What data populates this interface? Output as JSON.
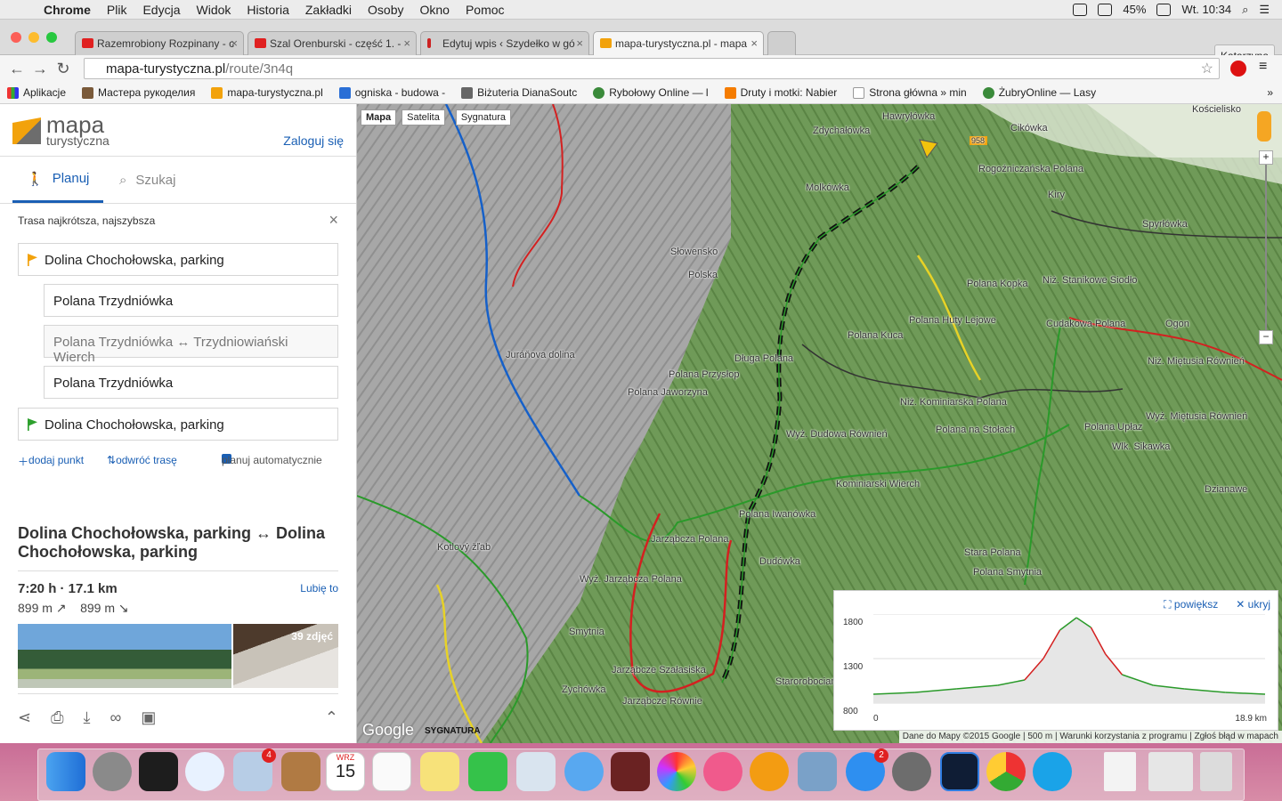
{
  "menubar": {
    "app": "Chrome",
    "items": [
      "Plik",
      "Edycja",
      "Widok",
      "Historia",
      "Zakładki",
      "Osoby",
      "Okno",
      "Pomoc"
    ],
    "battery": "45%",
    "clock": "Wt. 10:34"
  },
  "browser": {
    "tabs": [
      {
        "title": "Razemrobiony Rozpinany - c",
        "color": "#e02020"
      },
      {
        "title": "Szal Orenburski - część 1. -",
        "color": "#e02020"
      },
      {
        "title": "Edytuj wpis ‹ Szydełko w gó",
        "color": "#cc2222"
      },
      {
        "title": "mapa-turystyczna.pl - mapa",
        "color": "#f2a20c"
      }
    ],
    "profile": "Katarzyna",
    "url_host": "mapa-turystyczna.pl",
    "url_path": "/route/3n4q",
    "bookmarks": [
      "Aplikacje",
      "Мастера рукоделия",
      "mapa-turystyczna.pl",
      "ogniska - budowa -",
      "Biżuteria DianaSoutc",
      "Rybołowy Online — l",
      "Druty i motki: Nabier",
      "Strona główna » min",
      "ŻubryOnline — Lasy"
    ]
  },
  "panel": {
    "logo_top": "mapa",
    "logo_bottom": "turystyczna",
    "login": "Zaloguj się",
    "tab_plan": "Planuj",
    "tab_search": "Szukaj",
    "route_mode": "Trasa najkrótsza, najszybsza",
    "waypoints": [
      "Dolina Chochołowska, parking",
      "Polana Trzydniówka",
      "Polana Trzydniówka ↔ Trzydniowiański Wierch",
      "Polana Trzydniówka",
      "Dolina Chochołowska, parking"
    ],
    "add_point": "dodaj punkt",
    "reverse": "odwróć trasę",
    "auto_plan": "planuj automatycznie",
    "route_title": "Dolina Chochołowska, parking ↔ Dolina Chochołowska, parking",
    "time_distance": "7:20 h · 17.1 km",
    "like": "Lubię to",
    "ascent": "899 m",
    "descent": "899 m",
    "photos": "39 zdjęć"
  },
  "map": {
    "type_buttons": [
      "Mapa",
      "Satelita",
      "Sygnatura"
    ],
    "labels": [
      "Hawryłówka",
      "Zdychałówka",
      "Cikówka",
      "Kościelisko",
      "Rogoźniczańska Polana",
      "Molkówka",
      "Kiry",
      "Spyrłówka",
      "Polana Huty Lejowe",
      "Polana Kopka",
      "Polana Kuca",
      "Polana Przysłop",
      "Długa Polana",
      "Polana Jaworzyna",
      "Juráňova dolina",
      "Wyż. Dudowa Równień",
      "Kominiarski Wierch",
      "Polana Iwanówka",
      "Dudówka",
      "Kotlový žľab",
      "Jarząbcza Polana",
      "Wyż. Jarząbcza Polana",
      "Smytnia",
      "Jarząbcze Szałasiska",
      "Zychówka",
      "Jarząbcze Równie",
      "Starorobociańska",
      "Stara Polana",
      "Polana Smytnia",
      "Dzianawe",
      "Polana Upłaz",
      "Wlk. Sikawka",
      "Niż. Kominiarska Polana",
      "Polana na Stołach",
      "Cudakowa Polana",
      "Ogon",
      "Niż. Miętusia Równień",
      "Wyż. Miętusia Równień",
      "Słowensko",
      "Polska",
      "Niż. Stanikowe Siodło"
    ],
    "road_number": "958",
    "attribution": "Dane do Mapy ©2015 Google",
    "scale": "500 m",
    "terms": "Warunki korzystania z programu",
    "report": "Zgłoś błąd w mapach",
    "logo_text": "Google",
    "sygnatura": "SYGNATURA"
  },
  "elevation": {
    "expand": "powiększ",
    "hide": "ukryj",
    "y_ticks": [
      "1800",
      "1300",
      "800"
    ],
    "x_start": "0",
    "x_end": "18.9 km"
  },
  "chart_data": {
    "type": "area",
    "xlabel": "",
    "ylabel": "",
    "xlim": [
      0,
      18.9
    ],
    "ylim": [
      800,
      1800
    ],
    "x": [
      0,
      2,
      4,
      6,
      7.3,
      8.2,
      9,
      9.8,
      10.5,
      11.2,
      12,
      13.5,
      15,
      17,
      18.9
    ],
    "y": [
      900,
      920,
      960,
      1000,
      1060,
      1300,
      1620,
      1760,
      1650,
      1350,
      1120,
      1000,
      960,
      920,
      900
    ]
  },
  "dock": {
    "calendar_month": "WRZ",
    "calendar_day": "15",
    "mail_badge": "4",
    "appstore_badge": "2"
  }
}
